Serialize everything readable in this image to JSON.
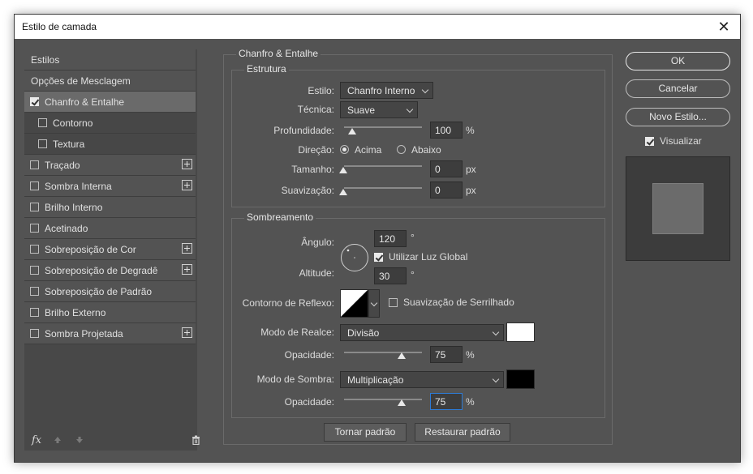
{
  "window": {
    "title": "Estilo de camada",
    "close_glyph": "✕"
  },
  "sidebar": {
    "items": [
      {
        "label": "Estilos",
        "checkbox": false,
        "checked": false,
        "plus": false,
        "selected": false,
        "sub": false
      },
      {
        "label": "Opções de Mesclagem",
        "checkbox": false,
        "checked": false,
        "plus": false,
        "selected": false,
        "sub": false
      },
      {
        "label": "Chanfro & Entalhe",
        "checkbox": true,
        "checked": true,
        "plus": false,
        "selected": true,
        "sub": false
      },
      {
        "label": "Contorno",
        "checkbox": true,
        "checked": false,
        "plus": false,
        "selected": false,
        "sub": true
      },
      {
        "label": "Textura",
        "checkbox": true,
        "checked": false,
        "plus": false,
        "selected": false,
        "sub": true
      },
      {
        "label": "Traçado",
        "checkbox": true,
        "checked": false,
        "plus": true,
        "selected": false,
        "sub": false
      },
      {
        "label": "Sombra Interna",
        "checkbox": true,
        "checked": false,
        "plus": true,
        "selected": false,
        "sub": false
      },
      {
        "label": "Brilho Interno",
        "checkbox": true,
        "checked": false,
        "plus": false,
        "selected": false,
        "sub": false
      },
      {
        "label": "Acetinado",
        "checkbox": true,
        "checked": false,
        "plus": false,
        "selected": false,
        "sub": false
      },
      {
        "label": "Sobreposição de Cor",
        "checkbox": true,
        "checked": false,
        "plus": true,
        "selected": false,
        "sub": false
      },
      {
        "label": "Sobreposição de Degradê",
        "checkbox": true,
        "checked": false,
        "plus": true,
        "selected": false,
        "sub": false
      },
      {
        "label": "Sobreposição de Padrão",
        "checkbox": true,
        "checked": false,
        "plus": false,
        "selected": false,
        "sub": false
      },
      {
        "label": "Brilho Externo",
        "checkbox": true,
        "checked": false,
        "plus": false,
        "selected": false,
        "sub": false
      },
      {
        "label": "Sombra Projetada",
        "checkbox": true,
        "checked": false,
        "plus": true,
        "selected": false,
        "sub": false
      }
    ],
    "footer": {
      "fx_label": "fx",
      "icons": [
        "move-up-icon",
        "move-down-icon",
        "trash-icon"
      ]
    }
  },
  "bevel": {
    "title": "Chanfro & Entalhe",
    "structure": {
      "title": "Estrutura",
      "style_label": "Estilo:",
      "style_value": "Chanfro Interno",
      "technique_label": "Técnica:",
      "technique_value": "Suave",
      "depth_label": "Profundidade:",
      "depth_value": "100",
      "depth_unit": "%",
      "depth_level": 0.0,
      "direction_label": "Direção:",
      "direction_up": "Acima",
      "direction_down": "Abaixo",
      "direction_selected": "Acima",
      "size_label": "Tamanho:",
      "size_value": "0",
      "size_unit": "px",
      "soften_label": "Suavização:",
      "soften_value": "0",
      "soften_unit": "px"
    },
    "shading": {
      "title": "Sombreamento",
      "angle_label": "Ângulo:",
      "angle_value": "120",
      "angle_unit": "°",
      "global_light_label": "Utilizar Luz Global",
      "global_light_checked": true,
      "altitude_label": "Altitude:",
      "altitude_value": "30",
      "altitude_unit": "°",
      "gloss_contour_label": "Contorno de Reflexo:",
      "anti_alias_label": "Suavização de Serrilhado",
      "anti_alias_checked": false,
      "highlight_mode_label": "Modo de Realce:",
      "highlight_mode_value": "Divisão",
      "highlight_color": "#ffffff",
      "highlight_opacity_label": "Opacidade:",
      "highlight_opacity_value": "75",
      "highlight_opacity_unit": "%",
      "shadow_mode_label": "Modo de Sombra:",
      "shadow_mode_value": "Multiplicação",
      "shadow_color": "#000000",
      "shadow_opacity_label": "Opacidade:",
      "shadow_opacity_value": "75",
      "shadow_opacity_unit": "%"
    },
    "make_default": "Tornar padrão",
    "reset_default": "Restaurar padrão"
  },
  "actions": {
    "ok": "OK",
    "cancel": "Cancelar",
    "new_style": "Novo Estilo...",
    "preview_label": "Visualizar",
    "preview_checked": true
  }
}
